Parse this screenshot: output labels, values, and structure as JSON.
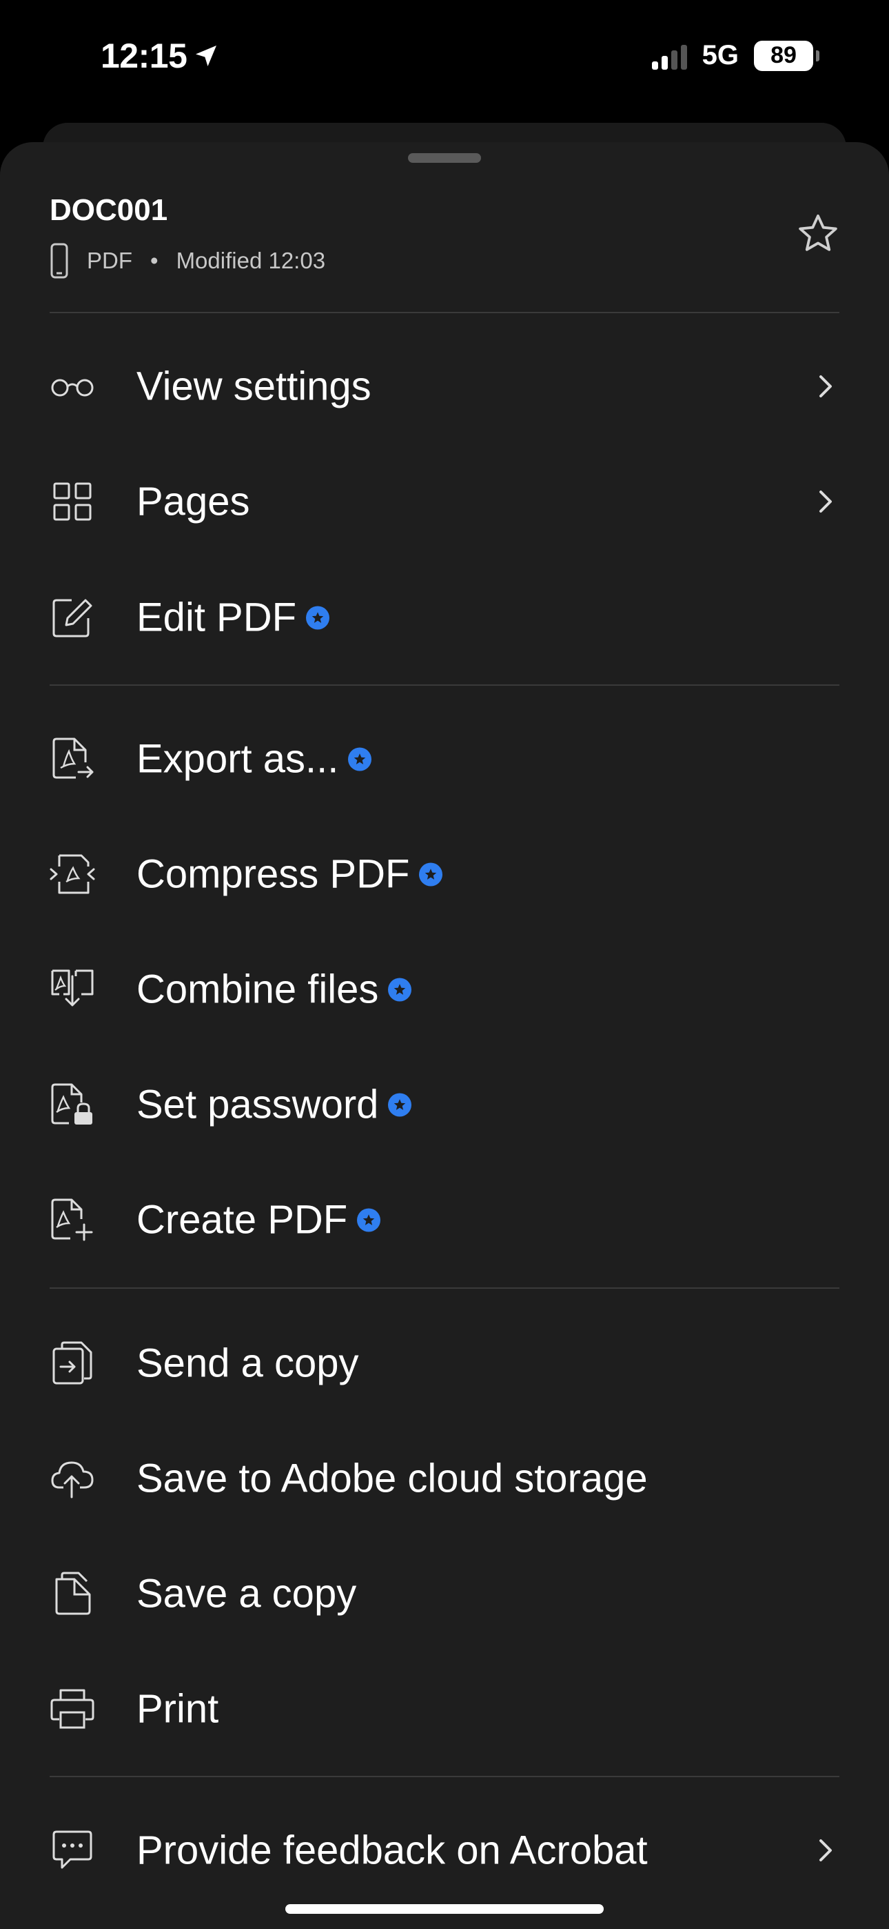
{
  "status": {
    "time": "12:15",
    "network": "5G",
    "battery": "89"
  },
  "document": {
    "title": "DOC001",
    "type": "PDF",
    "separator": "•",
    "modified": "Modified 12:03"
  },
  "menu": {
    "view_settings": "View settings",
    "pages": "Pages",
    "edit_pdf": "Edit PDF",
    "export_as": "Export as...",
    "compress_pdf": "Compress PDF",
    "combine_files": "Combine files",
    "set_password": "Set password",
    "create_pdf": "Create PDF",
    "send_copy": "Send a copy",
    "save_cloud": "Save to Adobe cloud storage",
    "save_copy": "Save a copy",
    "print": "Print",
    "feedback": "Provide feedback on Acrobat"
  },
  "colors": {
    "background": "#1e1e1e",
    "premium_badge": "#2f7ef0",
    "divider": "#3a3a3a"
  },
  "icons": {
    "premium": "premium-star-badge-icon",
    "chevron": "chevron-right-icon"
  }
}
